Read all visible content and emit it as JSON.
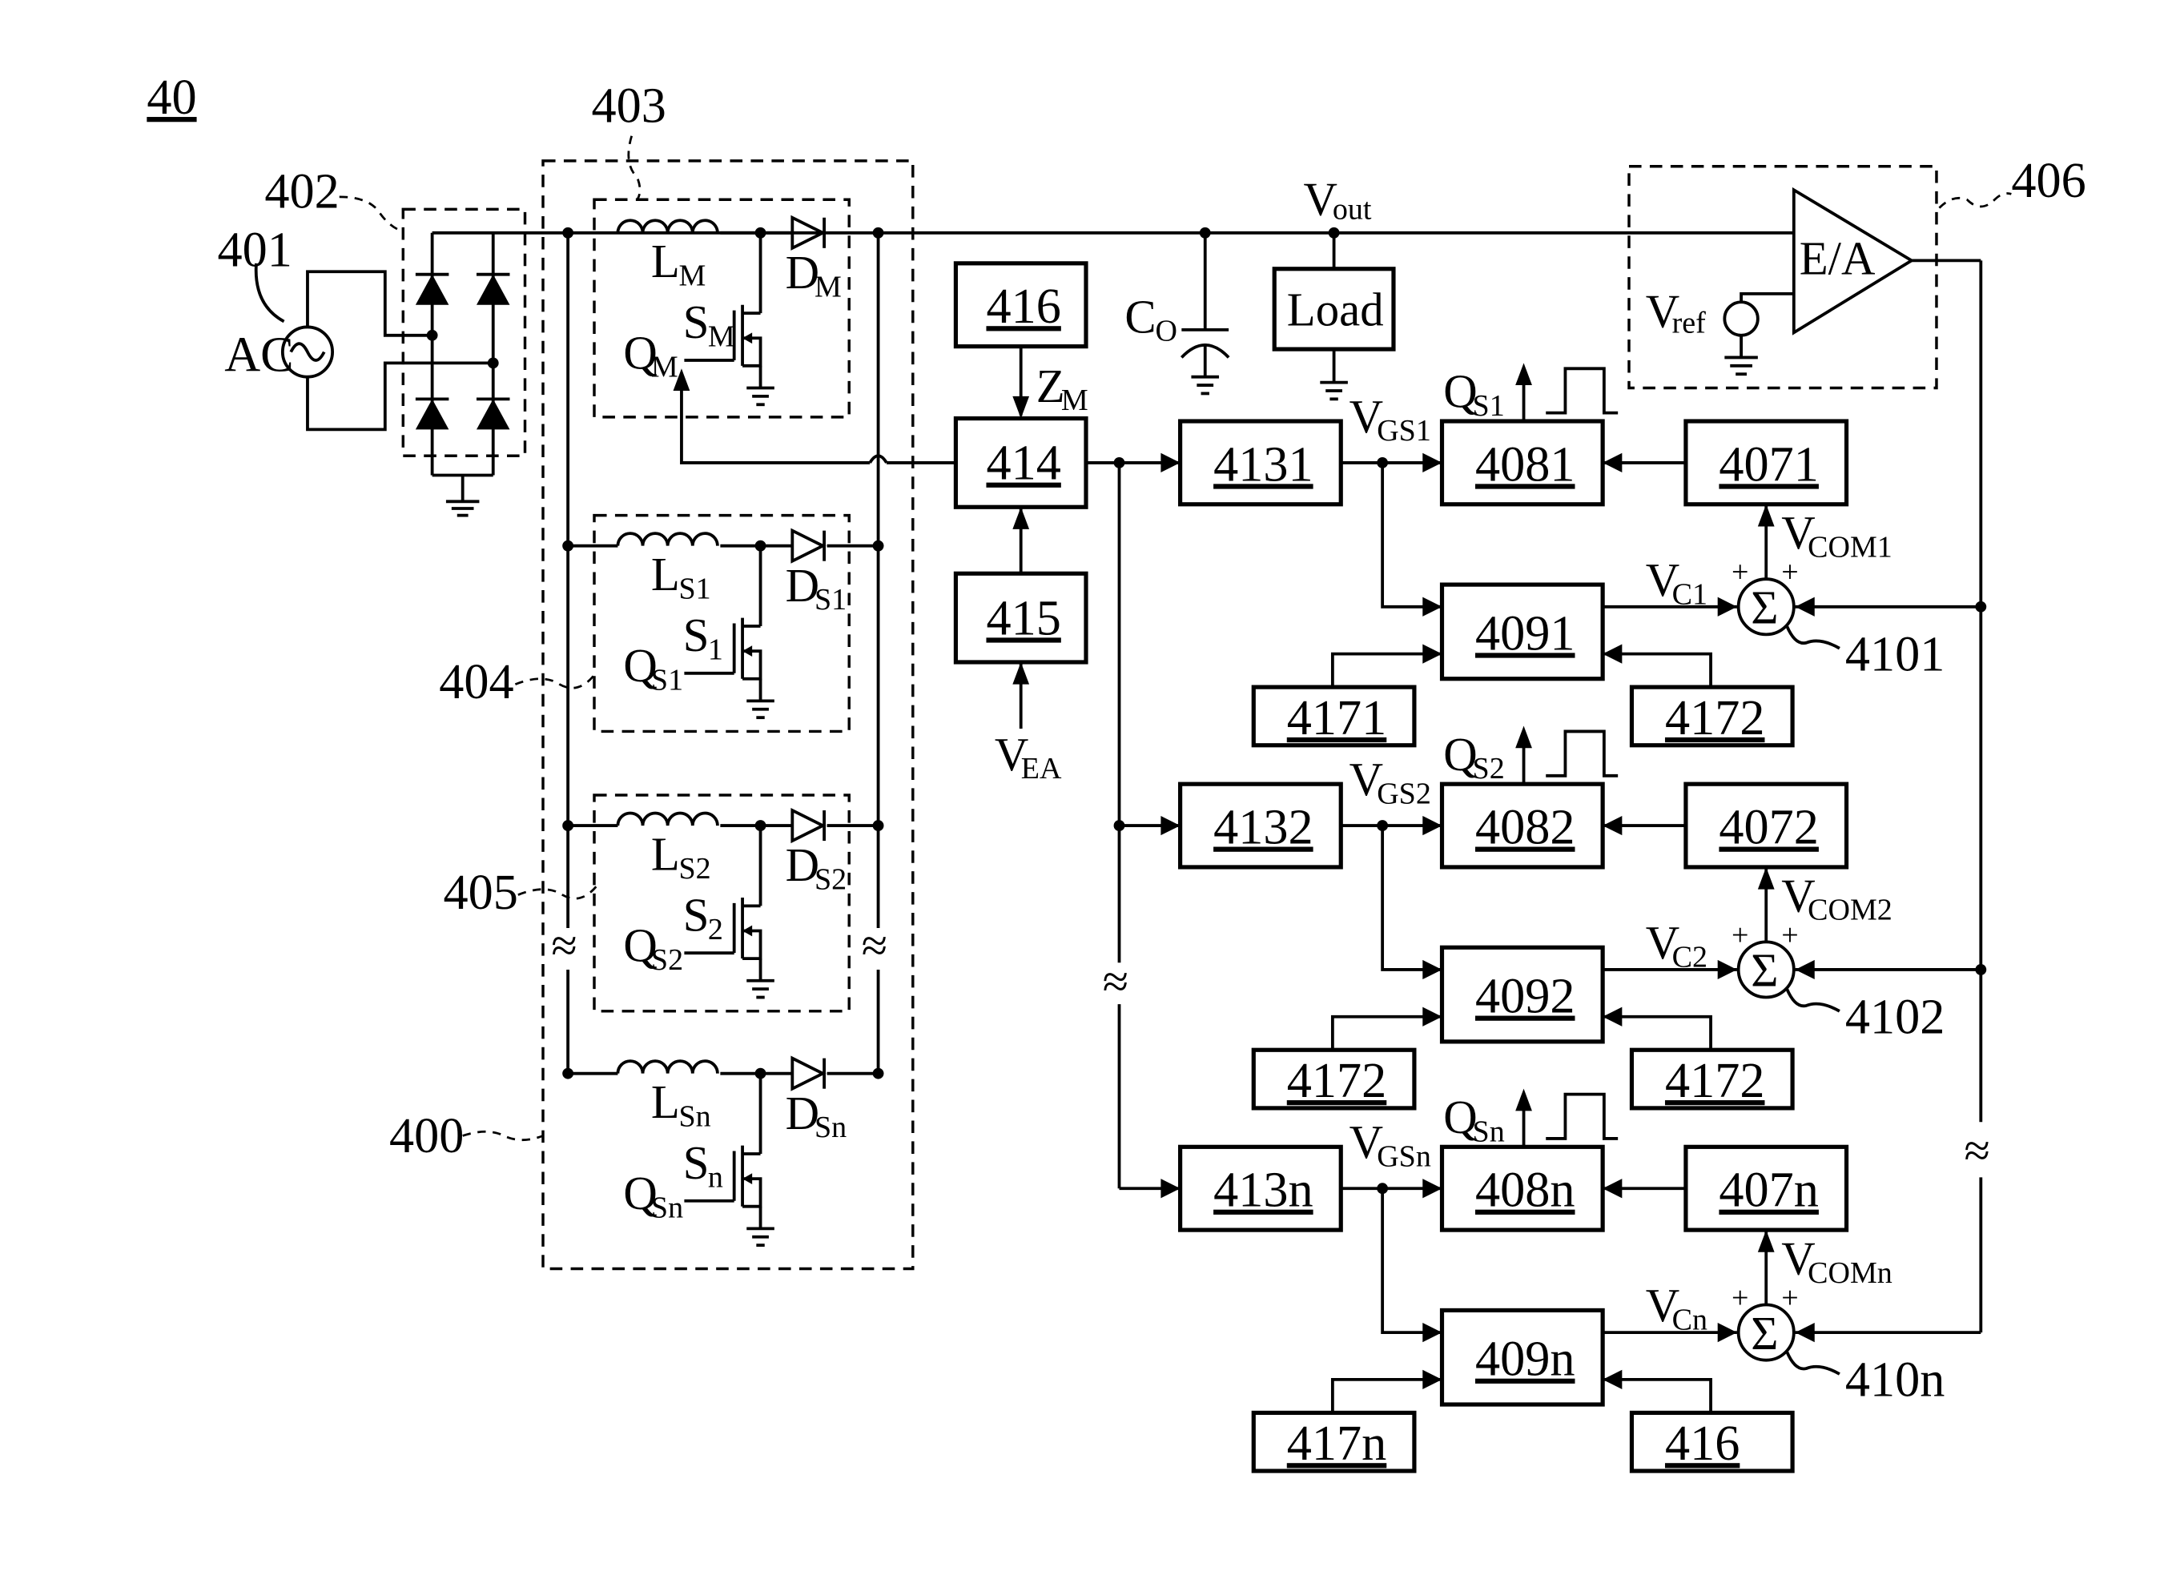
{
  "figure": {
    "ref": "40",
    "ac_source": {
      "ref": "401",
      "label": "AC"
    },
    "rectifier": {
      "ref": "402"
    },
    "converter_group": {
      "ref": "400"
    },
    "master_stage": {
      "ref": "403",
      "inductor": "L",
      "inductor_sub": "M",
      "diode": "D",
      "diode_sub": "M",
      "switch": "S",
      "switch_sub": "M",
      "gate": "Q",
      "gate_sub": "M"
    },
    "slave_stage_1": {
      "ref": "404",
      "inductor": "L",
      "inductor_sub": "S1",
      "diode": "D",
      "diode_sub": "S1",
      "switch": "S",
      "switch_sub": "1",
      "gate": "Q",
      "gate_sub": "S1"
    },
    "slave_stage_2": {
      "ref": "405",
      "inductor": "L",
      "inductor_sub": "S2",
      "diode": "D",
      "diode_sub": "S2",
      "switch": "S",
      "switch_sub": "2",
      "gate": "Q",
      "gate_sub": "S2"
    },
    "slave_stage_n": {
      "inductor": "L",
      "inductor_sub": "Sn",
      "diode": "D",
      "diode_sub": "Sn",
      "switch": "S",
      "switch_sub": "n",
      "gate": "Q",
      "gate_sub": "Sn"
    },
    "output": {
      "vout": "V",
      "vout_sub": "out",
      "cap": "C",
      "cap_sub": "O",
      "load": "Load"
    },
    "error_amp": {
      "ref": "406",
      "label": "E/A",
      "vref": "V",
      "vref_sub": "ref"
    },
    "blocks": {
      "b416_top": "416",
      "b414": "414",
      "b415": "415",
      "b4131": "4131",
      "b4132": "4132",
      "b413n": "413n",
      "b4081": "4081",
      "b4082": "4082",
      "b408n": "408n",
      "b4071": "4071",
      "b4072": "4072",
      "b407n": "407n",
      "b4091": "4091",
      "b4092": "4092",
      "b409n": "409n",
      "b4171": "4171",
      "b4172_r1": "4172",
      "b4172_l2": "4172",
      "b4172_r2": "4172",
      "b417n": "417n",
      "b416_bot": "416"
    },
    "summers": {
      "s1": "4101",
      "s2": "4102",
      "sn": "410n",
      "sigma": "Σ",
      "plus": "+"
    },
    "signals": {
      "zm": "Z",
      "zm_sub": "M",
      "vea": "V",
      "vea_sub": "EA",
      "vgs1": "V",
      "vgs1_sub": "GS1",
      "vgs2": "V",
      "vgs2_sub": "GS2",
      "vgsn": "V",
      "vgsn_sub": "GSn",
      "qs1": "Q",
      "qs1_sub": "S1",
      "qs2": "Q",
      "qs2_sub": "S2",
      "qsn": "Q",
      "qsn_sub": "Sn",
      "vc1": "V",
      "vc1_sub": "C1",
      "vc2": "V",
      "vc2_sub": "C2",
      "vcn": "V",
      "vcn_sub": "Cn",
      "vcom1": "V",
      "vcom1_sub": "COM1",
      "vcom2": "V",
      "vcom2_sub": "COM2",
      "vcomn": "V",
      "vcomn_sub": "COMn"
    },
    "break_symbol": "≈"
  }
}
